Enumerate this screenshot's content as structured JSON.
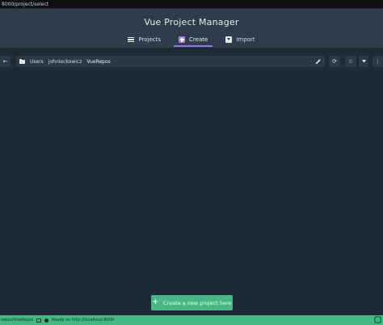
{
  "browser": {
    "url": "8000/project/select"
  },
  "header": {
    "title": "Vue Project Manager",
    "tabs": [
      {
        "label": "Projects",
        "icon": "list-icon",
        "active": false
      },
      {
        "label": "Create",
        "icon": "plus-box-icon",
        "active": true
      },
      {
        "label": "Import",
        "icon": "import-icon",
        "active": false
      }
    ]
  },
  "toolbar": {
    "back_glyph": "←",
    "path": [
      "Users",
      "johnleckowicz",
      "VueRepos"
    ],
    "refresh_glyph": "⟳",
    "favorite_glyph": "☆",
    "more_glyph": "⋮"
  },
  "main": {
    "create_label": "Create a new project here"
  },
  "statusbar": {
    "cwd": "owicz/VueRepos",
    "message": "Ready on http://localhost:8000"
  },
  "colors": {
    "header_bg": "#2d3d4b",
    "page_bg": "#1d2935",
    "accent_purple": "#8e7bd6",
    "primary_green": "#47b883"
  }
}
